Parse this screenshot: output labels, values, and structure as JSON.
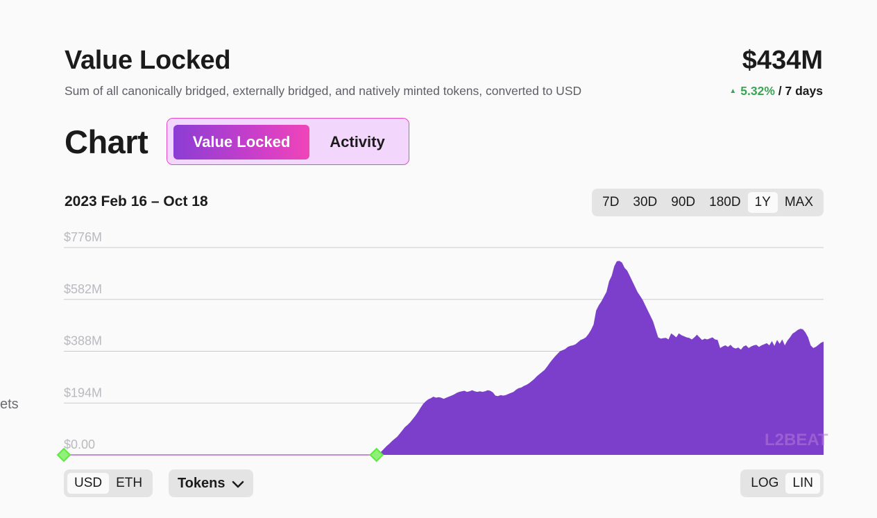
{
  "header": {
    "title": "Value Locked",
    "subtitle": "Sum of all canonically bridged, externally bridged, and natively minted tokens, converted to USD",
    "total_value": "$434M",
    "change_percent": "5.32%",
    "change_period": "/ 7 days",
    "change_direction": "up"
  },
  "chart_section": {
    "heading": "Chart",
    "tabs": [
      {
        "label": "Value Locked",
        "active": true
      },
      {
        "label": "Activity",
        "active": false
      }
    ],
    "date_range": "2023 Feb 16 – Oct 18",
    "range_buttons": [
      "7D",
      "30D",
      "90D",
      "180D",
      "1Y",
      "MAX"
    ],
    "selected_range": "1Y",
    "currency_buttons": [
      "USD",
      "ETH"
    ],
    "selected_currency": "USD",
    "tokens_label": "Tokens",
    "scale_buttons": [
      "LOG",
      "LIN"
    ],
    "selected_scale": "LIN",
    "watermark": "L2BEAT",
    "side_text": "ets"
  },
  "colors": {
    "area_fill": "#7c3fcc",
    "positive": "#3aa655",
    "marker": "#5ee840",
    "toggle_border": "#e44ac8"
  },
  "chart_data": {
    "type": "area",
    "title": "",
    "xlabel": "",
    "ylabel": "",
    "y_tick_labels": [
      "$0.00",
      "$194M",
      "$388M",
      "$582M",
      "$776M"
    ],
    "ylim": [
      0,
      776
    ],
    "unit": "$M",
    "x_range": [
      "2022 Oct 18",
      "2023 Oct 18"
    ],
    "grid": true,
    "series": [
      {
        "values": [
          0,
          0,
          0,
          0,
          0,
          0,
          0,
          0,
          0,
          0,
          0,
          0,
          0,
          0,
          0,
          0,
          0,
          0,
          0,
          0,
          0,
          0,
          0,
          0,
          0,
          0,
          0,
          0,
          0,
          0,
          0,
          0,
          0,
          0,
          0,
          0,
          0,
          0,
          0,
          0,
          0,
          0,
          0,
          0,
          0,
          0,
          0,
          0,
          0,
          0,
          0,
          0,
          0,
          0,
          0,
          0,
          0,
          0,
          0,
          0,
          0,
          0,
          0,
          0,
          0,
          0,
          0,
          0,
          0,
          0,
          0,
          0,
          0,
          0,
          0,
          0,
          0,
          0,
          0,
          0,
          0,
          0,
          0,
          0,
          0,
          0,
          0,
          0,
          0,
          0,
          0,
          0,
          0,
          0,
          0,
          0,
          0,
          0,
          0,
          0,
          0,
          0,
          0,
          0,
          0,
          0,
          0,
          0,
          0,
          0,
          0,
          0,
          0,
          0,
          0,
          0,
          0,
          0,
          0,
          0,
          0,
          0,
          5,
          14,
          24,
          34,
          42,
          52,
          60,
          68,
          80,
          92,
          104,
          112,
          122,
          134,
          146,
          160,
          176,
          190,
          200,
          208,
          212,
          218,
          214,
          216,
          214,
          210,
          214,
          218,
          222,
          226,
          232,
          236,
          238,
          240,
          236,
          238,
          242,
          238,
          236,
          238,
          236,
          238,
          242,
          240,
          234,
          222,
          220,
          224,
          222,
          224,
          228,
          232,
          236,
          244,
          250,
          252,
          258,
          262,
          268,
          276,
          284,
          294,
          302,
          310,
          318,
          330,
          344,
          356,
          368,
          378,
          388,
          392,
          396,
          404,
          408,
          410,
          414,
          422,
          430,
          434,
          440,
          452,
          468,
          488,
          540,
          560,
          574,
          592,
          610,
          650,
          670,
          706,
          725,
          726,
          720,
          700,
          690,
          670,
          650,
          630,
          610,
          595,
          580,
          560,
          540,
          520,
          500,
          470,
          440,
          435,
          437,
          438,
          432,
          455,
          448,
          440,
          455,
          448,
          444,
          440,
          438,
          432,
          440,
          450,
          440,
          430,
          435,
          432,
          436,
          440,
          432,
          430,
          400,
          406,
          410,
          404,
          412,
          402,
          398,
          402,
          394,
          406,
          410,
          400,
          406,
          410,
          412,
          404,
          410,
          414,
          418,
          410,
          426,
          408,
          430,
          416,
          432,
          410,
          428,
          440,
          454,
          460,
          468,
          472,
          470,
          458,
          440,
          410,
          400,
          404,
          412,
          420,
          424
        ]
      }
    ]
  }
}
